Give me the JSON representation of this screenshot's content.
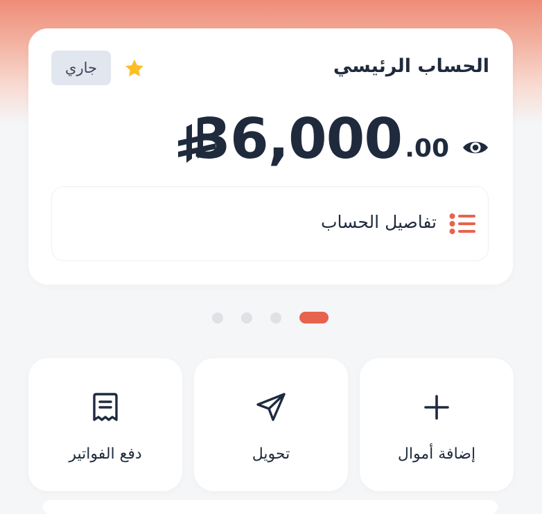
{
  "account": {
    "title": "الحساب الرئيسي",
    "type_badge": "جاري",
    "favorite_icon": "star-icon",
    "balance": {
      "amount": "36,000",
      "cents": ".00",
      "currency_icon": "saudi-riyal-icon"
    },
    "visibility_icon": "eye-icon",
    "details": {
      "label": "تفاصيل الحساب",
      "icon": "list-icon"
    }
  },
  "carousel": {
    "total": 4,
    "active_index": 0
  },
  "actions": [
    {
      "label": "إضافة أموال",
      "icon": "plus-icon"
    },
    {
      "label": "تحويل",
      "icon": "send-icon"
    },
    {
      "label": "دفع الفواتير",
      "icon": "receipt-icon"
    }
  ],
  "colors": {
    "accent": "#e8634d",
    "star": "#fbbf24",
    "text": "#1f2a3d",
    "badge_bg": "#e1e6ef"
  }
}
